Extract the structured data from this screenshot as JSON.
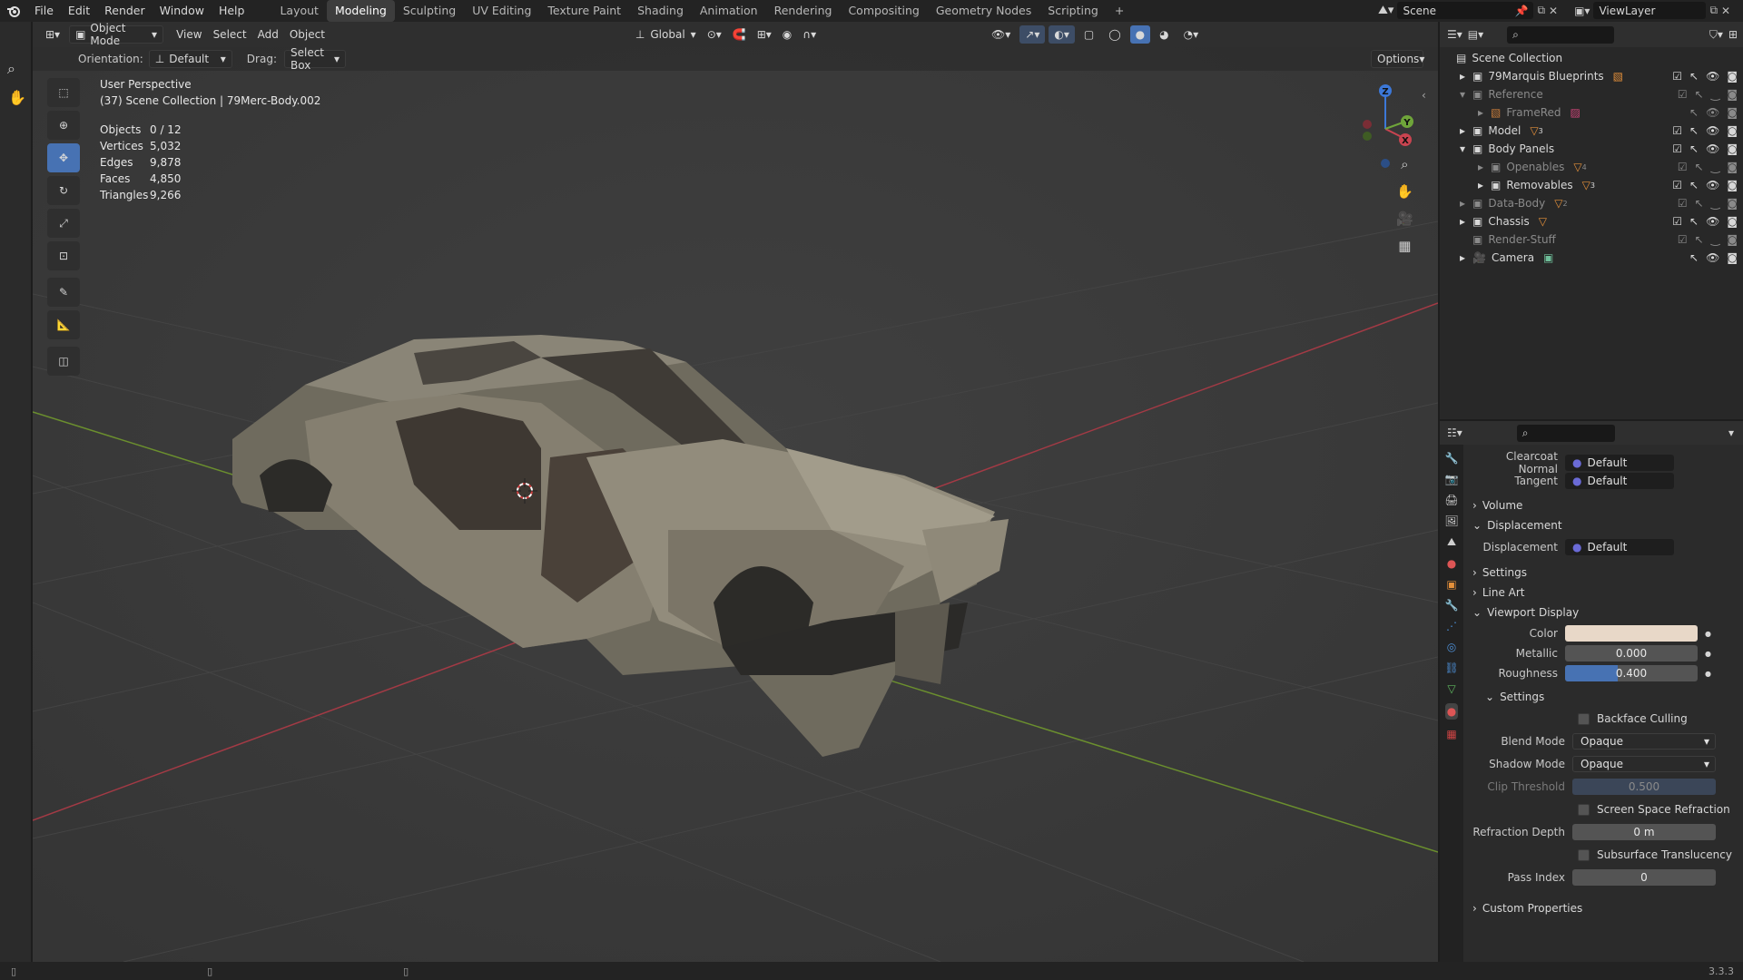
{
  "menu": [
    "File",
    "Edit",
    "Render",
    "Window",
    "Help"
  ],
  "workspaces": [
    "Layout",
    "Modeling",
    "Sculpting",
    "UV Editing",
    "Texture Paint",
    "Shading",
    "Animation",
    "Rendering",
    "Compositing",
    "Geometry Nodes",
    "Scripting"
  ],
  "active_workspace": "Modeling",
  "add_workspace": "+",
  "scene_name": "Scene",
  "view_layer": "ViewLayer",
  "viewport": {
    "mode": "Object Mode",
    "menus": [
      "View",
      "Select",
      "Add",
      "Object"
    ],
    "transform": "Global",
    "orientation_label": "Orientation:",
    "orientation_value": "Default",
    "drag_label": "Drag:",
    "drag_value": "Select Box",
    "options": "Options",
    "perspective": "User Perspective",
    "collection_info": "(37) Scene Collection | 79Merc-Body.002",
    "stats": [
      {
        "k": "Objects",
        "v": "0 / 12"
      },
      {
        "k": "Vertices",
        "v": "5,032"
      },
      {
        "k": "Edges",
        "v": "9,878"
      },
      {
        "k": "Faces",
        "v": "4,850"
      },
      {
        "k": "Triangles",
        "v": "9,266"
      }
    ],
    "gizmo": {
      "z": "Z",
      "x": "X",
      "y": "Y"
    }
  },
  "outliner": {
    "root": "Scene Collection",
    "items": [
      {
        "label": "79Marquis Blueprints",
        "badge": "",
        "dim": false
      },
      {
        "label": "Reference",
        "badge": "",
        "dim": true
      },
      {
        "label": "FrameRed",
        "badge": "",
        "dim": true
      },
      {
        "label": "Model",
        "badge": "3",
        "dim": false
      },
      {
        "label": "Body Panels",
        "badge": "",
        "dim": false
      },
      {
        "label": "Openables",
        "badge": "4",
        "dim": true
      },
      {
        "label": "Removables",
        "badge": "3",
        "dim": false
      },
      {
        "label": "Data-Body",
        "badge": "2",
        "dim": true
      },
      {
        "label": "Chassis",
        "badge": "",
        "dim": false
      },
      {
        "label": "Render-Stuff",
        "badge": "",
        "dim": true
      },
      {
        "label": "Camera",
        "badge": "",
        "dim": false
      }
    ]
  },
  "properties": {
    "clearcoat_label": "Clearcoat Normal",
    "clearcoat_value": "Default",
    "tangent_label": "Tangent",
    "tangent_value": "Default",
    "volume": "Volume",
    "displacement_section": "Displacement",
    "displacement_label": "Displacement",
    "displacement_value": "Default",
    "settings": "Settings",
    "line_art": "Line Art",
    "viewport_display": "Viewport Display",
    "color_label": "Color",
    "color_value": "#e8d8c8",
    "metallic_label": "Metallic",
    "metallic_value": "0.000",
    "roughness_label": "Roughness",
    "roughness_value": "0.400",
    "roughness_fraction": 0.4,
    "sub_settings": "Settings",
    "backface": "Backface Culling",
    "blend_label": "Blend Mode",
    "blend_value": "Opaque",
    "shadow_label": "Shadow Mode",
    "shadow_value": "Opaque",
    "clip_label": "Clip Threshold",
    "clip_value": "0.500",
    "ssr": "Screen Space Refraction",
    "refraction_label": "Refraction Depth",
    "refraction_value": "0 m",
    "subsurface": "Subsurface Translucency",
    "pass_label": "Pass Index",
    "pass_value": "0",
    "custom": "Custom Properties"
  },
  "version": "3.3.3"
}
